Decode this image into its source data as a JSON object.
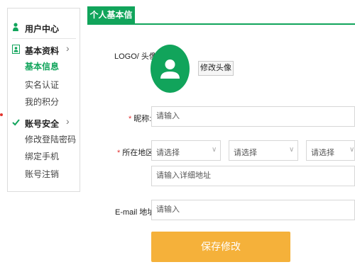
{
  "sidebar": {
    "header": "用户中心",
    "sections": [
      {
        "label": "基本资料",
        "items": [
          "基本信息",
          "实名认证",
          "我的积分"
        ]
      },
      {
        "label": "账号安全",
        "items": [
          "修改登陆密码",
          "绑定手机",
          "账号注销"
        ]
      }
    ]
  },
  "main": {
    "tab": "个人基本信息",
    "logo_label": "LOGO/ 头像",
    "change_avatar": "修改头像",
    "nickname_label": "昵称:",
    "nickname_placeholder": "请输入",
    "region_label": "所在地区:",
    "select_placeholder": "请选择",
    "address_placeholder": "请输入详细地址",
    "email_label": "E-mail 地址:",
    "email_placeholder": "请输入",
    "save": "保存修改",
    "required_mark": "*",
    "chevron": "›",
    "select_arrow": "∨"
  },
  "colors": {
    "accent": "#11a45b",
    "save_button": "#f5b13a",
    "required": "#e23131"
  }
}
